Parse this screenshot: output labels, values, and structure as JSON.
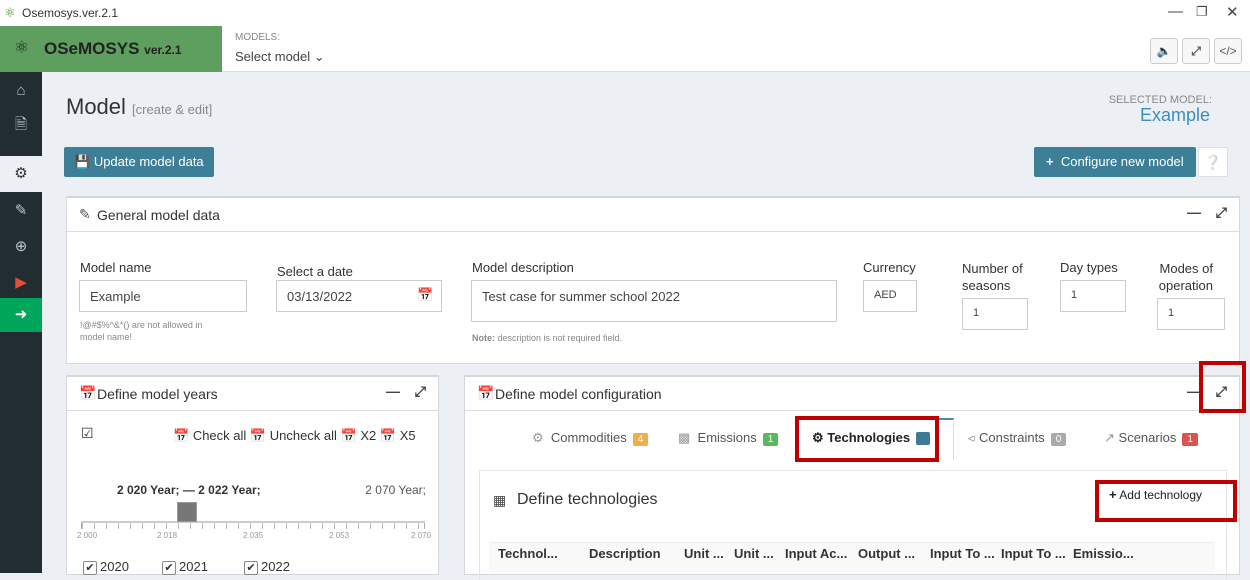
{
  "window": {
    "title": "Osemosys.ver.2.1"
  },
  "header": {
    "app_name": "OSeMOSYS",
    "app_version": "ver.2.1",
    "models_label": "MODELS:",
    "models_select": "Select model ⌄"
  },
  "page": {
    "title": "Model",
    "subtitle": "[create & edit]",
    "selected_label": "SELECTED MODEL:",
    "selected_value": "Example"
  },
  "toolbar": {
    "update_label": "Update model data",
    "configure_label": "Configure new model"
  },
  "general": {
    "title": "General model data",
    "model_name_label": "Model name",
    "model_name_value": "Example",
    "model_name_note1": "!@#$%^&*() are not allowed in",
    "model_name_note2": "model name!",
    "date_label": "Select a date",
    "date_value": "03/13/2022",
    "desc_label": "Model description",
    "desc_value": "Test case for summer school 2022",
    "desc_note_bold": "Note:",
    "desc_note": " description is not required field.",
    "currency_label": "Currency",
    "currency_value": "AED",
    "seasons_label1": "Number of",
    "seasons_label2": "seasons",
    "seasons_value": "1",
    "daytypes_label": "Day types",
    "daytypes_value": "1",
    "modes_label1": "Modes of",
    "modes_label2": "operation",
    "modes_value": "1"
  },
  "years": {
    "title": "Define model years",
    "check_all": "Check all",
    "uncheck_all": "Uncheck all",
    "x2": "X2",
    "x5": "X5",
    "range_label": "2 020 Year; — 2 022 Year;",
    "max_label": "2 070 Year;",
    "ticks": [
      "2 000",
      "2 018",
      "2 035",
      "2 053",
      "2 070"
    ],
    "items": [
      "2020",
      "2021",
      "2022"
    ]
  },
  "config": {
    "title": "Define model configuration",
    "tabs": [
      {
        "label": "Commodities",
        "count": "4",
        "color": "#f0ad4e"
      },
      {
        "label": "Emissions",
        "count": "1",
        "color": "#5cb85c"
      },
      {
        "label": "Technologies",
        "count": "",
        "color": "#3c7a95"
      },
      {
        "label": "Constraints",
        "count": "0",
        "color": "#999999"
      },
      {
        "label": "Scenarios",
        "count": "1",
        "color": "#d9534f"
      }
    ],
    "tech_title": "Define technologies",
    "add_tech": "Add technology",
    "columns": [
      "Technol...",
      "Description",
      "Unit ...",
      "Unit ...",
      "Input Ac...",
      "Output ...",
      "Input To ...",
      "Input To ...",
      "Emissio..."
    ]
  }
}
